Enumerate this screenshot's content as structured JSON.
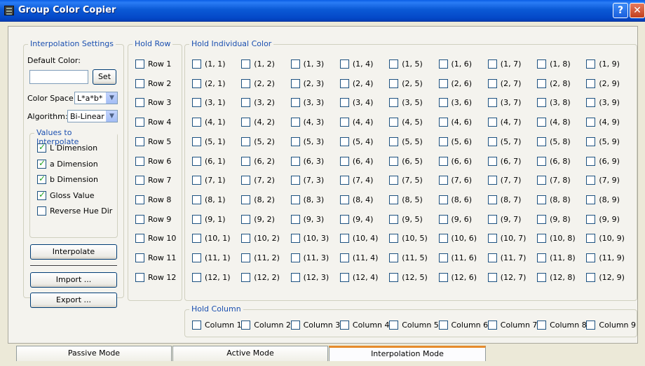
{
  "window": {
    "title": "Group Color Copier",
    "help_label": "?",
    "close_label": "✕"
  },
  "interp": {
    "legend": "Interpolation Settings",
    "default_color_label": "Default Color:",
    "default_color_value": "",
    "set_label": "Set",
    "color_space_label": "Color Space:",
    "color_space_value": "L*a*b*",
    "algorithm_label": "Algorithm:",
    "algorithm_value": "Bi-Linear",
    "values_legend": "Values to Interpolate",
    "values": [
      {
        "label": "L Dimension",
        "checked": true
      },
      {
        "label": "a Dimension",
        "checked": true
      },
      {
        "label": "b Dimension",
        "checked": true
      },
      {
        "label": "Gloss Value",
        "checked": true
      },
      {
        "label": "Reverse Hue Dir",
        "checked": false
      }
    ],
    "interpolate_label": "Interpolate",
    "import_label": "Import ...",
    "export_label": "Export ..."
  },
  "hold_row": {
    "legend": "Hold Row",
    "rows": [
      "Row 1",
      "Row 2",
      "Row 3",
      "Row 4",
      "Row 5",
      "Row 6",
      "Row 7",
      "Row 8",
      "Row 9",
      "Row 10",
      "Row 11",
      "Row 12"
    ]
  },
  "hold_color": {
    "legend": "Hold Individual Color",
    "cells": [
      [
        "(1, 1)",
        "(1, 2)",
        "(1, 3)",
        "(1, 4)",
        "(1, 5)",
        "(1, 6)",
        "(1, 7)",
        "(1, 8)",
        "(1, 9)"
      ],
      [
        "(2, 1)",
        "(2, 2)",
        "(2, 3)",
        "(2, 4)",
        "(2, 5)",
        "(2, 6)",
        "(2, 7)",
        "(2, 8)",
        "(2, 9)"
      ],
      [
        "(3, 1)",
        "(3, 2)",
        "(3, 3)",
        "(3, 4)",
        "(3, 5)",
        "(3, 6)",
        "(3, 7)",
        "(3, 8)",
        "(3, 9)"
      ],
      [
        "(4, 1)",
        "(4, 2)",
        "(4, 3)",
        "(4, 4)",
        "(4, 5)",
        "(4, 6)",
        "(4, 7)",
        "(4, 8)",
        "(4, 9)"
      ],
      [
        "(5, 1)",
        "(5, 2)",
        "(5, 3)",
        "(5, 4)",
        "(5, 5)",
        "(5, 6)",
        "(5, 7)",
        "(5, 8)",
        "(5, 9)"
      ],
      [
        "(6, 1)",
        "(6, 2)",
        "(6, 3)",
        "(6, 4)",
        "(6, 5)",
        "(6, 6)",
        "(6, 7)",
        "(6, 8)",
        "(6, 9)"
      ],
      [
        "(7, 1)",
        "(7, 2)",
        "(7, 3)",
        "(7, 4)",
        "(7, 5)",
        "(7, 6)",
        "(7, 7)",
        "(7, 8)",
        "(7, 9)"
      ],
      [
        "(8, 1)",
        "(8, 2)",
        "(8, 3)",
        "(8, 4)",
        "(8, 5)",
        "(8, 6)",
        "(8, 7)",
        "(8, 8)",
        "(8, 9)"
      ],
      [
        "(9, 1)",
        "(9, 2)",
        "(9, 3)",
        "(9, 4)",
        "(9, 5)",
        "(9, 6)",
        "(9, 7)",
        "(9, 8)",
        "(9, 9)"
      ],
      [
        "(10, 1)",
        "(10, 2)",
        "(10, 3)",
        "(10, 4)",
        "(10, 5)",
        "(10, 6)",
        "(10, 7)",
        "(10, 8)",
        "(10, 9)"
      ],
      [
        "(11, 1)",
        "(11, 2)",
        "(11, 3)",
        "(11, 4)",
        "(11, 5)",
        "(11, 6)",
        "(11, 7)",
        "(11, 8)",
        "(11, 9)"
      ],
      [
        "(12, 1)",
        "(12, 2)",
        "(12, 3)",
        "(12, 4)",
        "(12, 5)",
        "(12, 6)",
        "(12, 7)",
        "(12, 8)",
        "(12, 9)"
      ]
    ]
  },
  "hold_column": {
    "legend": "Hold Column",
    "columns": [
      "Column 1",
      "Column 2",
      "Column 3",
      "Column 4",
      "Column 5",
      "Column 6",
      "Column 7",
      "Column 8",
      "Column 9"
    ]
  },
  "tabs": [
    {
      "label": "Passive Mode",
      "active": false
    },
    {
      "label": "Active Mode",
      "active": false
    },
    {
      "label": "Interpolation Mode",
      "active": true
    }
  ],
  "colors": {
    "title_bar": "#0b5ad6",
    "legend_text": "#1a4fb0",
    "active_tab_accent": "#e68b2c",
    "check_mark": "#21a121"
  }
}
